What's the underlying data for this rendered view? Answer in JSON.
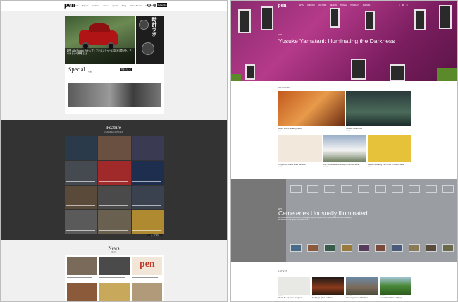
{
  "left_page": {
    "nav": {
      "logo": "pen",
      "menu": [
        "Life",
        "Sports",
        "Fashion",
        "Travel",
        "Sports",
        "Blog",
        "Video Studio",
        "Celebrities"
      ],
      "subscribe_label": "Subscribe"
    },
    "hero": {
      "caption": "新型 Alfa Romeo のトップ・アドベンチャーに向けて見せた、そのひとつの戦略とは",
      "side_text": "時計ラボ"
    },
    "special": {
      "title": "Special",
      "subtitle": "特集",
      "button": "特集をもっと見る"
    },
    "feature": {
      "title": "Feature",
      "subtitle": "FEATURED ARTICLES",
      "more_button": "もっと見る"
    },
    "news": {
      "title": "News",
      "subtitle": "NEWS",
      "tile_logo": "pen"
    }
  },
  "right_page": {
    "nav": {
      "logo": "pen",
      "menu": [
        "ARTS",
        "FASHION",
        "CULTURE",
        "DESIGN",
        "TRAVEL",
        "PRODUCT",
        "AGENDA"
      ],
      "icons": [
        "search-icon",
        "language-icon",
        "menu-icon"
      ]
    },
    "hero": {
      "kicker": "ART",
      "title": "Yusuke Yamatani: Illuminating the Darkness"
    },
    "archives": {
      "label": "ARCHIVES",
      "cards": [
        {
          "caption": "What's Behind Breaking Taboos",
          "category": "ART"
        },
        {
          "caption": "Nomadic Hotels Hotel",
          "category": "TRAVEL"
        },
        {
          "caption": "Tokyo's New Places to Eat Well Well",
          "category": "FOOD"
        },
        {
          "caption": "What Should Japan Build Beyond the Boundaries",
          "category": "DESIGN"
        },
        {
          "caption": "Fashion Illustrating The Portrait of Modern Japan",
          "category": "ART"
        }
      ]
    },
    "feature_band": {
      "kicker": "ART",
      "title": "Cemeteries Unusually Illuminated",
      "description": "An unprecedented exhibition of photography explores Japan's most mysterious and eccentric funerary architecture in the light of the modern era."
    },
    "latest": {
      "label": "LATEST",
      "cards": [
        {
          "category": "DESIGN",
          "caption": "What's the Japanese Designers"
        },
        {
          "category": "ART",
          "caption": "Sculpting Light in the Stone"
        },
        {
          "category": "CULTURE",
          "caption": "Gathering Stories of Tradition"
        },
        {
          "category": "TRAVEL",
          "caption": "Tea Fields of Shizuoka Spring"
        }
      ]
    }
  },
  "colors": {
    "feature_band_bg": "#333333",
    "hero_magenta": "#b53a8a",
    "accent_red": "#c0392b"
  }
}
